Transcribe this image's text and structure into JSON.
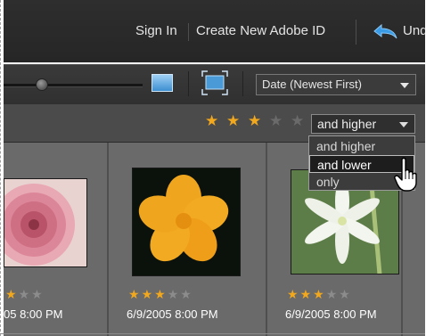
{
  "header": {
    "sign_in": "Sign In",
    "create_id": "Create New Adobe ID",
    "undo_label": "Und"
  },
  "toolbar": {
    "zoom_slider_value": 0.26,
    "sort_selected": "Date (Newest First)"
  },
  "filter": {
    "stars": [
      "on",
      "on",
      "on",
      "off",
      "off"
    ],
    "rating_selected": "and higher",
    "rating_options": [
      "and higher",
      "and lower",
      "only"
    ],
    "highlighted_option": "and lower",
    "star_color": "#f2a81d"
  },
  "photos": [
    {
      "stars": [
        "on",
        "off",
        "off"
      ],
      "date": "05 8:00 PM"
    },
    {
      "stars": [
        "on",
        "on",
        "on",
        "off",
        "off"
      ],
      "date": "6/9/2005 8:00 PM"
    },
    {
      "stars": [
        "on",
        "on",
        "on",
        "off",
        "off"
      ],
      "date": "6/9/2005 8:00 PM"
    }
  ]
}
